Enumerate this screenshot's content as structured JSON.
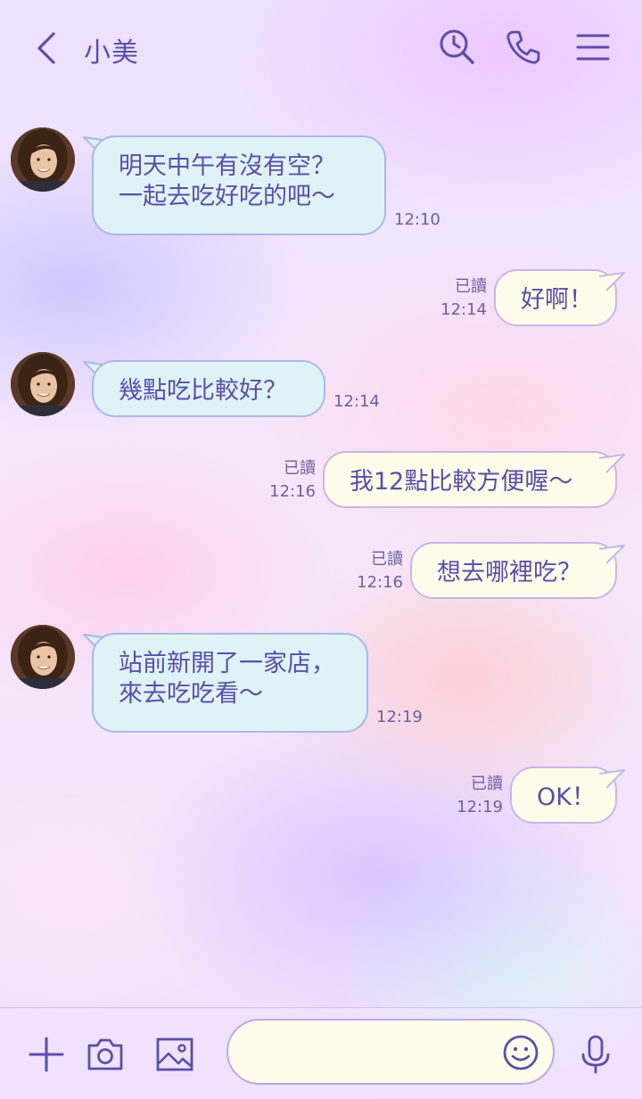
{
  "header": {
    "title": "小美",
    "icons": [
      "back-icon",
      "search-history-icon",
      "phone-icon",
      "menu-icon"
    ]
  },
  "messages": [
    {
      "side": "in",
      "lines": [
        "明天中午有沒有空？",
        "一起去吃好吃的吧～"
      ],
      "time": "12:10"
    },
    {
      "side": "out",
      "text": "好啊！",
      "read": "已讀",
      "time": "12:14"
    },
    {
      "side": "in",
      "lines": [
        "幾點吃比較好？"
      ],
      "time": "12:14"
    },
    {
      "side": "out",
      "text": "我12點比較方便喔～",
      "read": "已讀",
      "time": "12:16"
    },
    {
      "side": "out",
      "text": "想去哪裡吃？",
      "read": "已讀",
      "time": "12:16"
    },
    {
      "side": "in",
      "lines": [
        "站前新開了一家店，",
        "來去吃吃看～"
      ],
      "time": "12:19"
    },
    {
      "side": "out",
      "text": "OK！",
      "read": "已讀",
      "time": "12:19"
    }
  ],
  "input": {
    "value": "",
    "placeholder": ""
  },
  "toolbar_icons": [
    "plus-icon",
    "camera-icon",
    "image-icon",
    "emoji-icon",
    "microphone-icon"
  ],
  "colors": {
    "accent": "#5a4fa8",
    "bubble_in": "#dff3f7",
    "bubble_out": "#fffbea"
  }
}
